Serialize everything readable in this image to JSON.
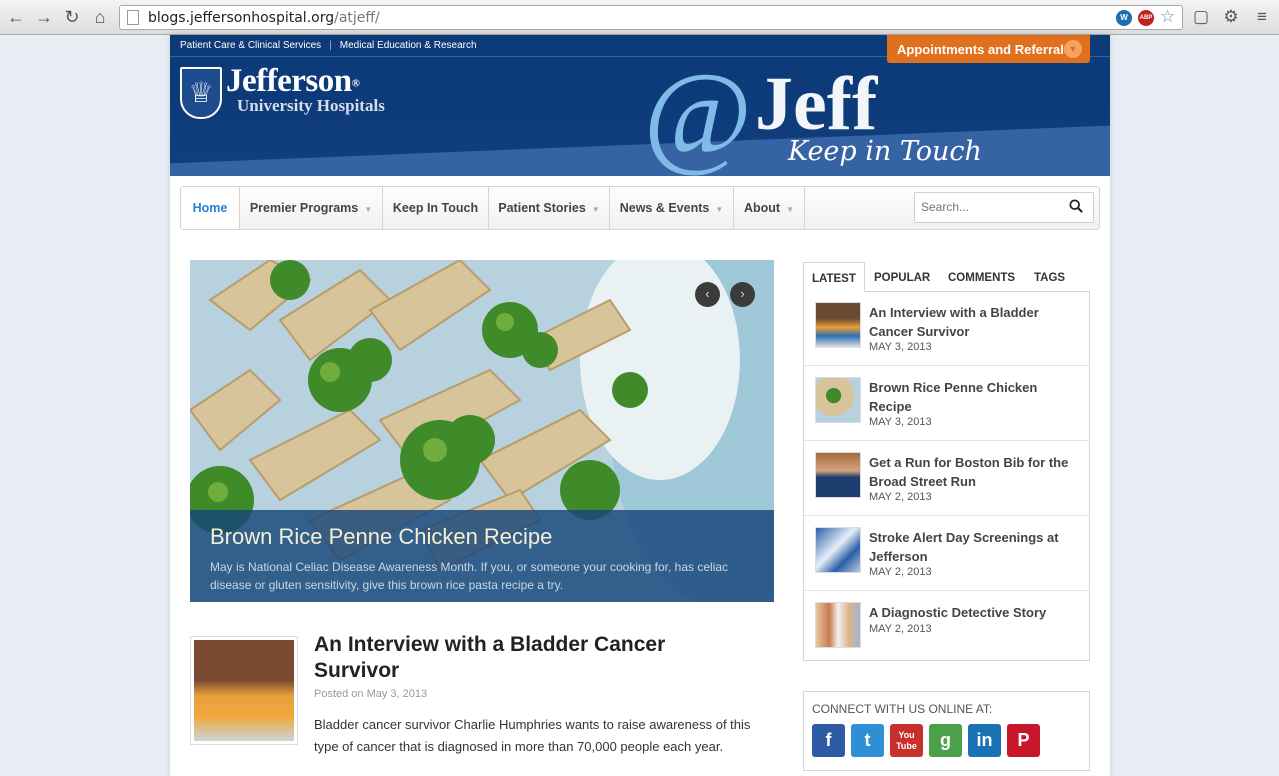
{
  "browser": {
    "url_host": "blogs.jeffersonhospital.org",
    "url_path": "/atjeff/",
    "ext_wp": "W",
    "ext_abp": "ABP"
  },
  "header": {
    "top_links": [
      "Patient Care & Clinical Services",
      "Medical Education & Research"
    ],
    "separator": "|",
    "appointments": "Appointments and Referrals",
    "logo_name": "Jefferson",
    "logo_reg": "®",
    "logo_sub": "University Hospitals",
    "brand_at": "@",
    "brand_jeff": "Jeff",
    "brand_tag": "Keep in Touch"
  },
  "nav": {
    "items": [
      {
        "label": "Home",
        "dropdown": false
      },
      {
        "label": "Premier Programs",
        "dropdown": true
      },
      {
        "label": "Keep In Touch",
        "dropdown": false
      },
      {
        "label": "Patient Stories",
        "dropdown": true
      },
      {
        "label": "News & Events",
        "dropdown": true
      },
      {
        "label": "About",
        "dropdown": true
      }
    ],
    "search_placeholder": "Search..."
  },
  "slider": {
    "title": "Brown Rice Penne Chicken Recipe",
    "text": "May is National Celiac Disease Awareness Month. If you, or someone your cooking for, has celiac disease or gluten sensitivity, give this brown rice pasta recipe a try."
  },
  "post": {
    "title": "An Interview with a Bladder Cancer Survivor",
    "date": "Posted on May 3, 2013",
    "excerpt": "Bladder cancer survivor Charlie Humphries wants to raise awareness of this type of cancer that is diagnosed in more than 70,000 people each year."
  },
  "sidebar": {
    "tabs": [
      "LATEST",
      "POPULAR",
      "COMMENTS",
      "TAGS"
    ],
    "latest": [
      {
        "title": "An Interview with a Bladder Cancer Survivor",
        "date": "MAY 3, 2013"
      },
      {
        "title": "Brown Rice Penne Chicken Recipe",
        "date": "MAY 3, 2013"
      },
      {
        "title": "Get a Run for Boston Bib for the Broad Street Run",
        "date": "MAY 2, 2013"
      },
      {
        "title": "Stroke Alert Day Screenings at Jefferson",
        "date": "MAY 2, 2013"
      },
      {
        "title": "A Diagnostic Detective Story",
        "date": "MAY 2, 2013"
      }
    ],
    "connect_heading": "CONNECT WITH US ONLINE AT:",
    "social": [
      {
        "name": "facebook",
        "glyph": "f",
        "color": "#2d5aa3"
      },
      {
        "name": "twitter",
        "glyph": "t",
        "color": "#2f8fd4"
      },
      {
        "name": "youtube",
        "glyph": "You Tube",
        "color": "#c9302c"
      },
      {
        "name": "google",
        "glyph": "g",
        "color": "#4aa14a"
      },
      {
        "name": "linkedin",
        "glyph": "in",
        "color": "#1a72b5"
      },
      {
        "name": "pinterest",
        "glyph": "P",
        "color": "#c8162a"
      }
    ]
  }
}
